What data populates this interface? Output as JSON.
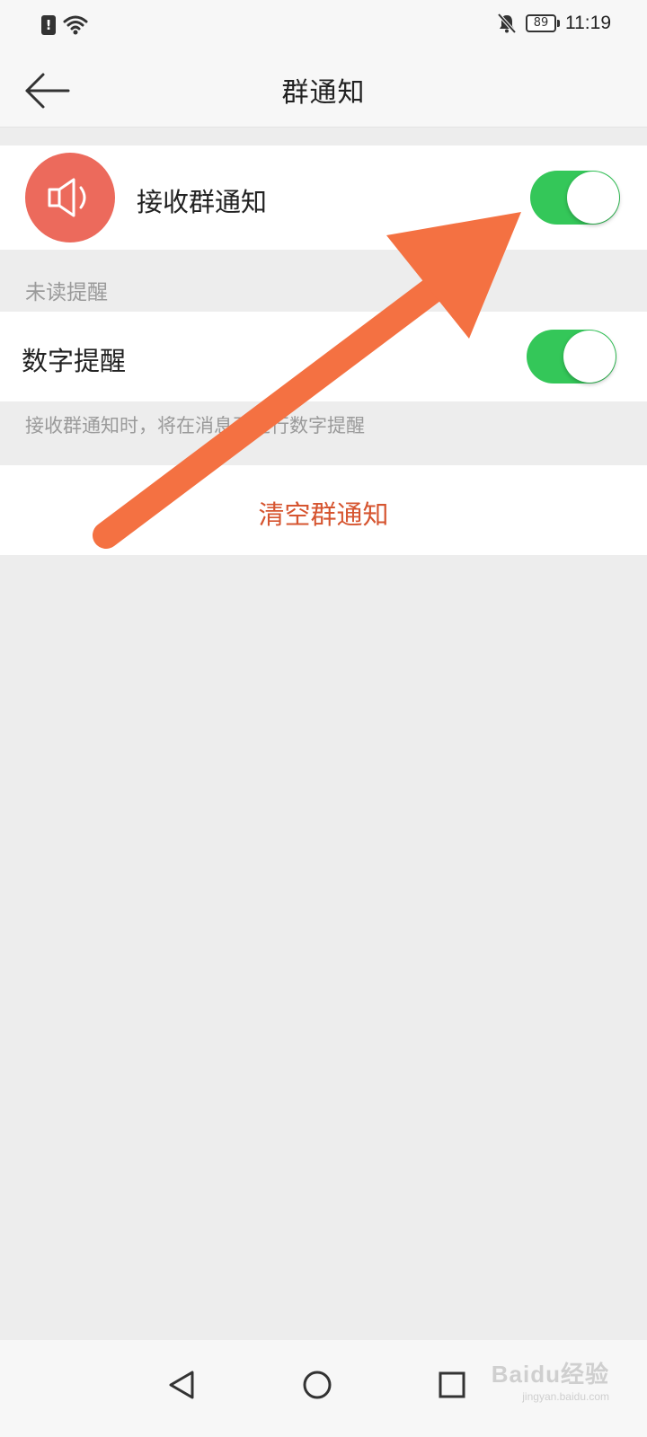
{
  "status_bar": {
    "battery_level": "89",
    "time": "11:19",
    "icons": [
      "alert-icon",
      "wifi-icon",
      "bell-muted-icon",
      "battery-icon"
    ]
  },
  "nav": {
    "title": "群通知",
    "back_icon": "back-arrow-icon"
  },
  "receive_row": {
    "label": "接收群通知",
    "icon": "speaker-icon",
    "icon_color": "#ec6a5c",
    "toggle_on": true
  },
  "unread_section": {
    "header": "未读提醒",
    "digit_row": {
      "label": "数字提醒",
      "toggle_on": true
    },
    "description": "接收群通知时，将在消息页进行数字提醒"
  },
  "clear_action": {
    "label": "清空群通知",
    "color": "#d65530"
  },
  "system_nav": {
    "icons": [
      "nav-back-icon",
      "nav-home-icon",
      "nav-recents-icon"
    ]
  },
  "watermark": {
    "logo": "Baidu经验",
    "site": "jingyan.baidu.com"
  },
  "colors": {
    "toggle_on": "#34c759",
    "annotation_arrow": "#f47142",
    "background": "#ededed"
  }
}
